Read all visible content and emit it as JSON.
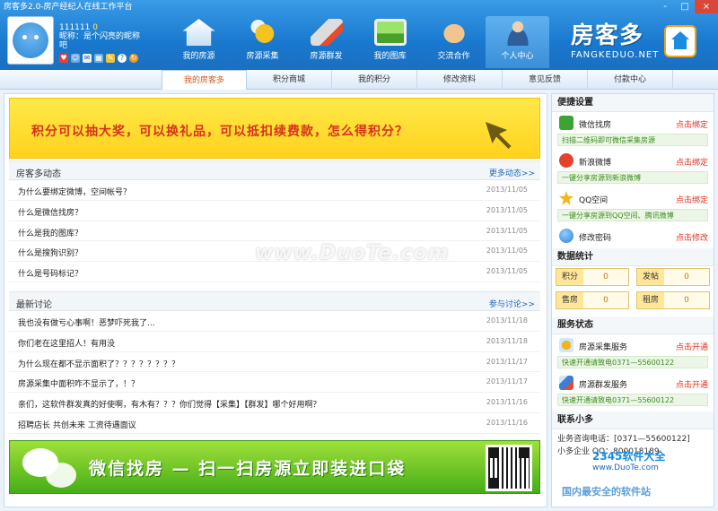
{
  "window": {
    "title": "房客多2.0-房产经纪人在线工作平台",
    "controls": [
      "-",
      "□",
      "×"
    ]
  },
  "user": {
    "id": "111111",
    "level": "0",
    "nickname": "昵称：是个闪亮的昵称",
    "nickname_wrap": "吧",
    "tools": [
      "heart-icon",
      "people-icon",
      "mail-icon",
      "grid-icon",
      "pencil-icon",
      "help-icon",
      "refresh-icon"
    ]
  },
  "nav": [
    {
      "label": "我的房源",
      "icon": "house-icon"
    },
    {
      "label": "房源采集",
      "icon": "bee-icon"
    },
    {
      "label": "房源群发",
      "icon": "rocket-icon"
    },
    {
      "label": "我的图库",
      "icon": "picture-icon"
    },
    {
      "label": "交流合作",
      "icon": "handshake-icon"
    },
    {
      "label": "个人中心",
      "icon": "person-icon",
      "active": true
    }
  ],
  "brand": {
    "cn": "房客多",
    "en": "FANGKEDUO.NET"
  },
  "subtabs": [
    "我的房客多",
    "积分商城",
    "我的积分",
    "修改资料",
    "意见反馈",
    "付款中心"
  ],
  "banner_top": "积分可以抽大奖，可以换礼品，可以抵扣续费款，怎么得积分？",
  "news": {
    "title": "房客多动态",
    "more": "更多动态>>",
    "rows": [
      {
        "q": "为什么要绑定微博，空间帐号？",
        "d": "2013/11/05"
      },
      {
        "q": "什么是微信找房？",
        "d": "2013/11/05"
      },
      {
        "q": "什么是我的图库？",
        "d": "2013/11/05"
      },
      {
        "q": "什么是搜狗识别？",
        "d": "2013/11/05"
      },
      {
        "q": "什么是号码标记？",
        "d": "2013/11/05"
      }
    ]
  },
  "discuss": {
    "title": "最新讨论",
    "more": "参与讨论>>",
    "rows": [
      {
        "q": "我也没有做亏心事啊！恶梦吓死我了...",
        "d": "2013/11/18"
      },
      {
        "q": "你们老在这里招人！有用没",
        "d": "2013/11/18"
      },
      {
        "q": "为什么现在都不显示面积了？？？？？？？？",
        "d": "2013/11/17"
      },
      {
        "q": "房源采集中面积咋不显示了，！？",
        "d": "2013/11/17"
      },
      {
        "q": "亲们，这软件群发真的好使啊，有木有？？？你们觉得【采集】【群发】哪个好用啊？",
        "d": "2013/11/16"
      },
      {
        "q": "招聘店长 共创未来 工资待遇面议",
        "d": "2013/11/16"
      }
    ]
  },
  "banner_bottom": "微信找房 — 扫一扫房源立即装进口袋",
  "side": {
    "settings_title": "便捷设置",
    "binds": [
      {
        "label": "微信找房",
        "action": "点击绑定",
        "tip": "扫描二维码即可微信采集房源",
        "icon": "wechat-icon",
        "color": "#3aa535"
      },
      {
        "label": "新浪微博",
        "action": "点击绑定",
        "tip": "一键分享房源到新浪微博",
        "icon": "weibo-icon",
        "color": "#e5412d"
      },
      {
        "label": "QQ空间",
        "action": "点击绑定",
        "tip": "一键分享房源到QQ空间、腾讯微博",
        "icon": "qzone-icon",
        "color": "#f3b51c"
      },
      {
        "label": "修改密码",
        "action": "点击修改",
        "tip": "",
        "icon": "globe-icon",
        "color": "#2f7fd4"
      }
    ],
    "stats_title": "数据统计",
    "stats": [
      {
        "k": "积分",
        "v": "0"
      },
      {
        "k": "发帖",
        "v": "0"
      },
      {
        "k": "售房",
        "v": "0"
      },
      {
        "k": "租房",
        "v": "0"
      }
    ],
    "service_title": "服务状态",
    "services": [
      {
        "label": "房源采集服务",
        "action": "点击开通",
        "tip": "快速开通请致电0371—55600122",
        "icon": "bee-icon",
        "color": "#f2b41a"
      },
      {
        "label": "房源群发服务",
        "action": "点击开通",
        "tip": "快速开通请致电0371—55600122",
        "icon": "rocket-icon",
        "color": "#3b7fd2"
      }
    ],
    "contact_title": "联系小多",
    "contact_phone": "业务咨询电话：[0371—55600122]",
    "contact_qq": "小多企业 QQ：800018189"
  },
  "watermarks": {
    "main": "www.DuoTe.com",
    "site1": "2345软件大全",
    "site1_url": "www.DuoTe.com",
    "site2": "国内最安全的软件站"
  }
}
